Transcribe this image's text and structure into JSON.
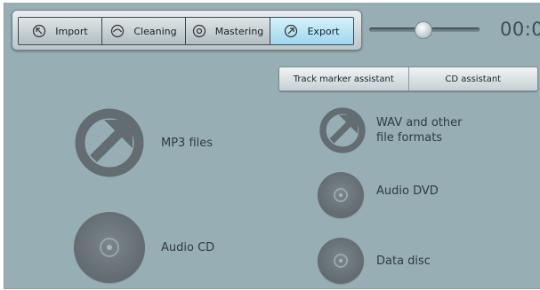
{
  "tabs": [
    {
      "label": "Import",
      "icon": "import-icon"
    },
    {
      "label": "Cleaning",
      "icon": "cleaning-icon"
    },
    {
      "label": "Mastering",
      "icon": "mastering-icon"
    },
    {
      "label": "Export",
      "icon": "export-icon",
      "active": true
    }
  ],
  "slider": {
    "position_fraction": 0.48
  },
  "time": {
    "display": "00:0"
  },
  "assistants": {
    "track_marker": "Track marker assistant",
    "cd": "CD assistant"
  },
  "export_items": {
    "mp3": "MP3 files",
    "audio_cd": "Audio CD",
    "wav_line1": "WAV and other",
    "wav_line2": "file formats",
    "audio_dvd": "Audio DVD",
    "data_disc": "Data disc"
  },
  "colors": {
    "background": "#97aeb4",
    "active_tab": "#a9ddf1",
    "icon_gray": "#636c70"
  }
}
